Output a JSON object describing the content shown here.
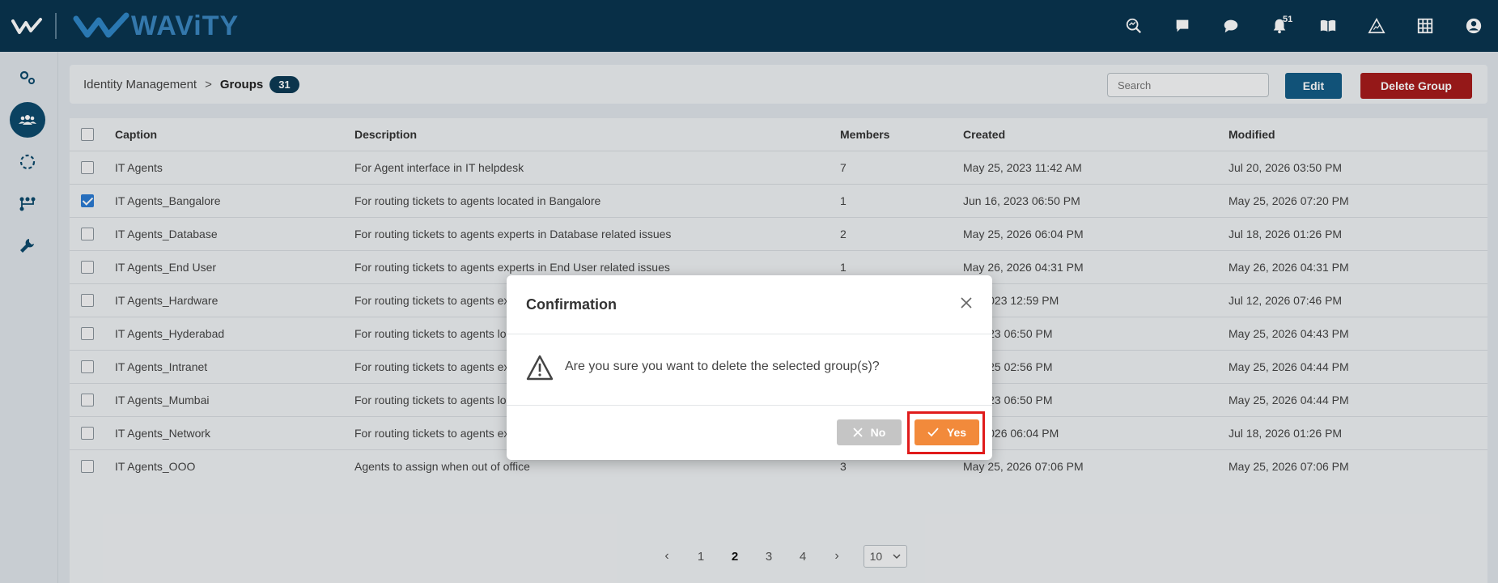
{
  "app": {
    "brand": "WAViTY",
    "notification_count": "51",
    "top_icons": [
      "search-analytics-icon",
      "chat-square-icon",
      "chat-bubble-icon",
      "bell-icon",
      "book-icon",
      "warning-icon",
      "grid-icon",
      "user-icon"
    ]
  },
  "nav": {
    "items": [
      "settings-gears-icon",
      "groups-icon",
      "dashed-circle-icon",
      "workflow-icon",
      "wrench-icon"
    ],
    "active": "groups-icon"
  },
  "header": {
    "breadcrumb_root": "Identity Management",
    "breadcrumb_sep": ">",
    "breadcrumb_current": "Groups",
    "count": "31",
    "search_placeholder": "Search",
    "edit_label": "Edit",
    "delete_label": "Delete Group"
  },
  "table": {
    "columns": [
      "Caption",
      "Description",
      "Members",
      "Created",
      "Modified"
    ],
    "rows": [
      {
        "checked": false,
        "caption": "IT Agents",
        "description": "For Agent interface in IT helpdesk",
        "members": "7",
        "created": "May 25, 2023 11:42 AM",
        "modified": "Jul 20, 2026 03:50 PM"
      },
      {
        "checked": true,
        "caption": "IT Agents_Bangalore",
        "description": "For routing tickets to agents located in Bangalore",
        "members": "1",
        "created": "Jun 16, 2023 06:50 PM",
        "modified": "May 25, 2026 07:20 PM"
      },
      {
        "checked": false,
        "caption": "IT Agents_Database",
        "description": "For routing tickets to agents experts in Database related issues",
        "members": "2",
        "created": "May 25, 2026 06:04 PM",
        "modified": "Jul 18, 2026 01:26 PM"
      },
      {
        "checked": false,
        "caption": "IT Agents_End User",
        "description": "For routing tickets to agents experts in End User related issues",
        "members": "1",
        "created": "May 26, 2026 04:31 PM",
        "modified": "May 26, 2026 04:31 PM"
      },
      {
        "checked": false,
        "caption": "IT Agents_Hardware",
        "description": "For routing tickets to agents ex",
        "members": "",
        "created": "29, 2023 12:59 PM",
        "modified": "Jul 12, 2026 07:46 PM"
      },
      {
        "checked": false,
        "caption": "IT Agents_Hyderabad",
        "description": "For routing tickets to agents lo",
        "members": "",
        "created": "6, 2023 06:50 PM",
        "modified": "May 25, 2026 04:43 PM"
      },
      {
        "checked": false,
        "caption": "IT Agents_Intranet",
        "description": "For routing tickets to agents ex",
        "members": "",
        "created": "9, 2025 02:56 PM",
        "modified": "May 25, 2026 04:44 PM"
      },
      {
        "checked": false,
        "caption": "IT Agents_Mumbai",
        "description": "For routing tickets to agents lo",
        "members": "",
        "created": "6, 2023 06:50 PM",
        "modified": "May 25, 2026 04:44 PM"
      },
      {
        "checked": false,
        "caption": "IT Agents_Network",
        "description": "For routing tickets to agents ex",
        "members": "",
        "created": "25, 2026 06:04 PM",
        "modified": "Jul 18, 2026 01:26 PM"
      },
      {
        "checked": false,
        "caption": "IT Agents_OOO",
        "description": "Agents to assign when out of office",
        "members": "3",
        "created": "May 25, 2026 07:06 PM",
        "modified": "May 25, 2026 07:06 PM"
      }
    ]
  },
  "pager": {
    "prev": "‹",
    "next": "›",
    "pages": [
      "1",
      "2",
      "3",
      "4"
    ],
    "current": "2",
    "page_size": "10"
  },
  "modal": {
    "title": "Confirmation",
    "message": "Are you sure you want to delete the selected group(s)?",
    "no_label": "No",
    "yes_label": "Yes"
  },
  "colors": {
    "topbar": "#0a3550",
    "edit": "#135c86",
    "delete": "#a61b1b",
    "yes": "#f28a3b",
    "no": "#c5c5c5",
    "highlight": "#e01b1b"
  }
}
